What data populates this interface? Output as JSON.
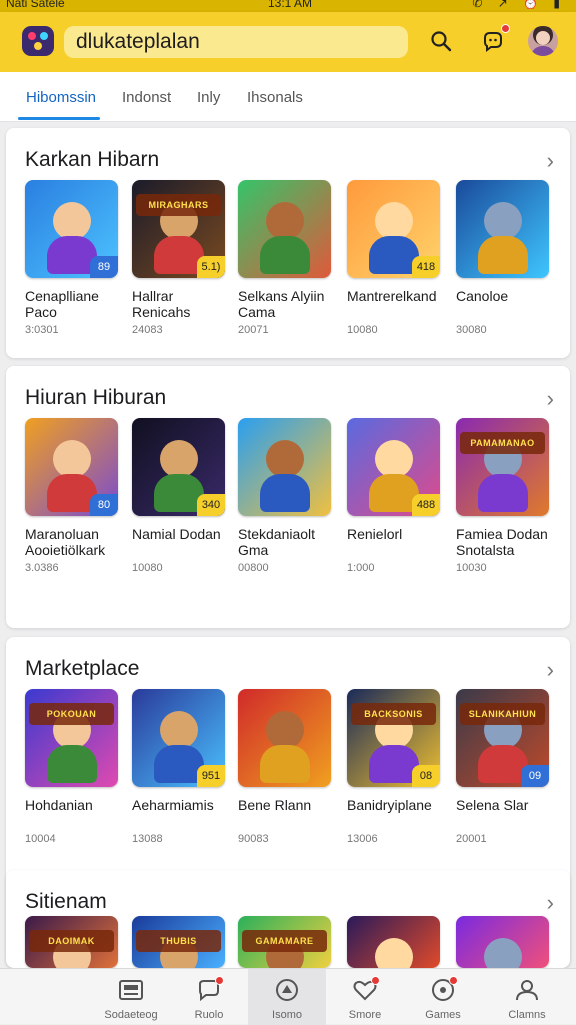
{
  "status": {
    "carrier": "Nati Satele",
    "time": "13:1 AM",
    "icons": "✆ ↗ ⏰ ▮"
  },
  "search": {
    "value": "dlukateplalan"
  },
  "colors": {
    "header": "#f7cf2a",
    "accent": "#1e88e5",
    "badge": "#e53935"
  },
  "tabs": [
    "Hibomssin",
    "Indonst",
    "Inly",
    "Ihsonals"
  ],
  "sections": [
    {
      "title": "Karkan Hibarn",
      "apps": [
        {
          "name": "Cenaplliane\nPaco",
          "meta": "3:0301",
          "count": "89",
          "banner": ""
        },
        {
          "name": "Hallrar\nRenicahs",
          "meta": "24083",
          "count": "5.1)",
          "banner": "MIRAGHARS"
        },
        {
          "name": "Selkans Alyiin\nCama",
          "meta": "20071",
          "count": "",
          "banner": ""
        },
        {
          "name": "Mantrerelkand",
          "meta": "10080",
          "count": "418",
          "banner": ""
        },
        {
          "name": "Canoloe",
          "meta": "30080",
          "count": "",
          "banner": ""
        }
      ]
    },
    {
      "title": "Hiuran Hiburan",
      "apps": [
        {
          "name": "Maranoluan\nAooietiölkark",
          "meta": "3.0386",
          "count": "80",
          "banner": ""
        },
        {
          "name": "Namial Dodan",
          "meta": "10080",
          "count": "340",
          "banner": ""
        },
        {
          "name": "Stekdaniaolt\nGma",
          "meta": "00800",
          "count": "",
          "banner": ""
        },
        {
          "name": "Renielorl",
          "meta": "1:000",
          "count": "488",
          "banner": ""
        },
        {
          "name": "Famiea Dodan\nSnotalsta",
          "meta": "10030",
          "count": "",
          "banner": "PAMAMANAO"
        }
      ]
    },
    {
      "title": "Marketplace",
      "apps": [
        {
          "name": "Hohdanian",
          "meta": "10004",
          "count": "",
          "banner": "POKOUAN"
        },
        {
          "name": "Aeharmiamis",
          "meta": "13088",
          "count": "951",
          "banner": ""
        },
        {
          "name": "Bene Rlann",
          "meta": "90083",
          "count": "",
          "banner": ""
        },
        {
          "name": "Banidryiplane",
          "meta": "13006",
          "count": "08",
          "banner": "BACKSONIS"
        },
        {
          "name": "Selena Slar",
          "meta": "20001",
          "count": "09",
          "banner": "SLANIKAHIUN"
        }
      ]
    },
    {
      "title": "Sitienam",
      "apps": [
        {
          "name": "",
          "meta": "",
          "count": "",
          "banner": "DAOIMAK"
        },
        {
          "name": "",
          "meta": "",
          "count": "",
          "banner": "THUBIS"
        },
        {
          "name": "",
          "meta": "",
          "count": "",
          "banner": "GAMAMARE"
        },
        {
          "name": "",
          "meta": "",
          "count": "",
          "banner": ""
        },
        {
          "name": "",
          "meta": "",
          "count": "",
          "banner": ""
        }
      ]
    }
  ],
  "nav": [
    {
      "label": "Sodaeteog",
      "icon": "news-icon"
    },
    {
      "label": "Ruolo",
      "icon": "chat-icon"
    },
    {
      "label": "Isomo",
      "icon": "home-icon"
    },
    {
      "label": "Smore",
      "icon": "heart-icon"
    },
    {
      "label": "Games",
      "icon": "game-icon"
    },
    {
      "label": "Clamns",
      "icon": "profile-icon"
    }
  ]
}
